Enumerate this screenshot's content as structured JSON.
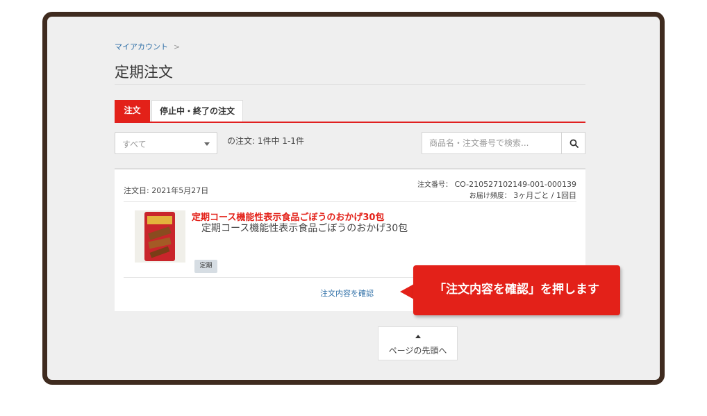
{
  "breadcrumb": {
    "item": "マイアカウント",
    "separator": ">"
  },
  "page_title": "定期注文",
  "tabs": [
    {
      "label": "注文",
      "active": true
    },
    {
      "label": "停止中・終了の注文",
      "active": false
    }
  ],
  "filter": {
    "selected": "すべて",
    "count_text": "の注文: 1件中 1-1件"
  },
  "search": {
    "placeholder": "商品名・注文番号で検索...",
    "icon": "search-icon"
  },
  "order": {
    "date_text": "注文日: 2021年5月27日",
    "number_label": "注文番号：",
    "number": "CO-210527102149-001-000139",
    "frequency_label": "お届け頻度：",
    "frequency": "3ヶ月ごと / 1回目",
    "product_title": "定期コース機能性表示食品ごぼうのおかげ30包",
    "product_name": "定期コース機能性表示食品ごぼうのおかげ30包",
    "badge": "定期",
    "confirm_link": "注文内容を確認"
  },
  "callout": {
    "text": "「注文内容を確認」を押します"
  },
  "page_top": {
    "label": "ページの先頭へ"
  },
  "colors": {
    "accent": "#e32119",
    "frame": "#3f2b1f",
    "link": "#2f6fa7",
    "background": "#efefef"
  }
}
